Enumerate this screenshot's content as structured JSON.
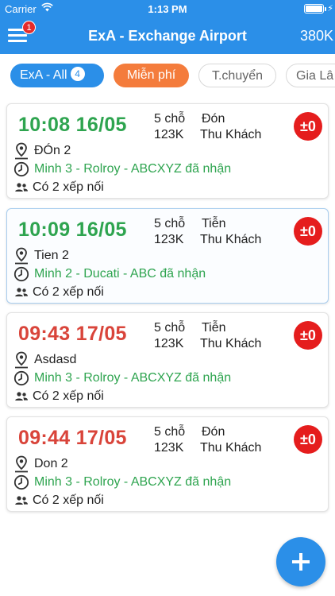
{
  "status_bar": {
    "carrier": "Carrier",
    "time": "1:13 PM"
  },
  "header": {
    "title": "ExA - Exchange Airport",
    "balance": "380K",
    "notification_count": "1",
    "color": "#2b8fe8"
  },
  "filters": [
    {
      "label": "ExA - All",
      "count": "4"
    },
    {
      "label": "Miễn phí"
    },
    {
      "label": "T.chuyển"
    },
    {
      "label": "Gia Lâ"
    }
  ],
  "trips": [
    {
      "time": "10:08 16/05",
      "time_color": "green",
      "seats": "5 chỗ",
      "type": "Đón",
      "price": "123K",
      "collect": "Thu Khách",
      "balance": "±0",
      "location": "ĐÓn 2",
      "driver": "Minh 3 - Rolroy - ABCXYZ đã nhận",
      "seat_info": "Có 2 xếp nối",
      "selected": false
    },
    {
      "time": "10:09 16/05",
      "time_color": "green",
      "seats": "5 chỗ",
      "type": "Tiễn",
      "price": "123K",
      "collect": "Thu Khách",
      "balance": "±0",
      "location": "Tien 2",
      "driver": "Minh 2 - Ducati - ABC đã nhận",
      "seat_info": "Có 2 xếp nối",
      "selected": true
    },
    {
      "time": "09:43 17/05",
      "time_color": "red",
      "seats": "5 chỗ",
      "type": "Tiễn",
      "price": "123K",
      "collect": "Thu Khách",
      "balance": "±0",
      "location": "Asdasd",
      "driver": "Minh 3 - Rolroy - ABCXYZ đã nhận",
      "seat_info": "Có 2 xếp nối",
      "selected": false
    },
    {
      "time": "09:44 17/05",
      "time_color": "red",
      "seats": "5 chỗ",
      "type": "Đón",
      "price": "123K",
      "collect": "Thu Khách",
      "balance": "±0",
      "location": "Don 2",
      "driver": "Minh 3 - Rolroy - ABCXYZ đã nhận",
      "seat_info": "Có 2 xếp nối",
      "selected": false
    }
  ]
}
